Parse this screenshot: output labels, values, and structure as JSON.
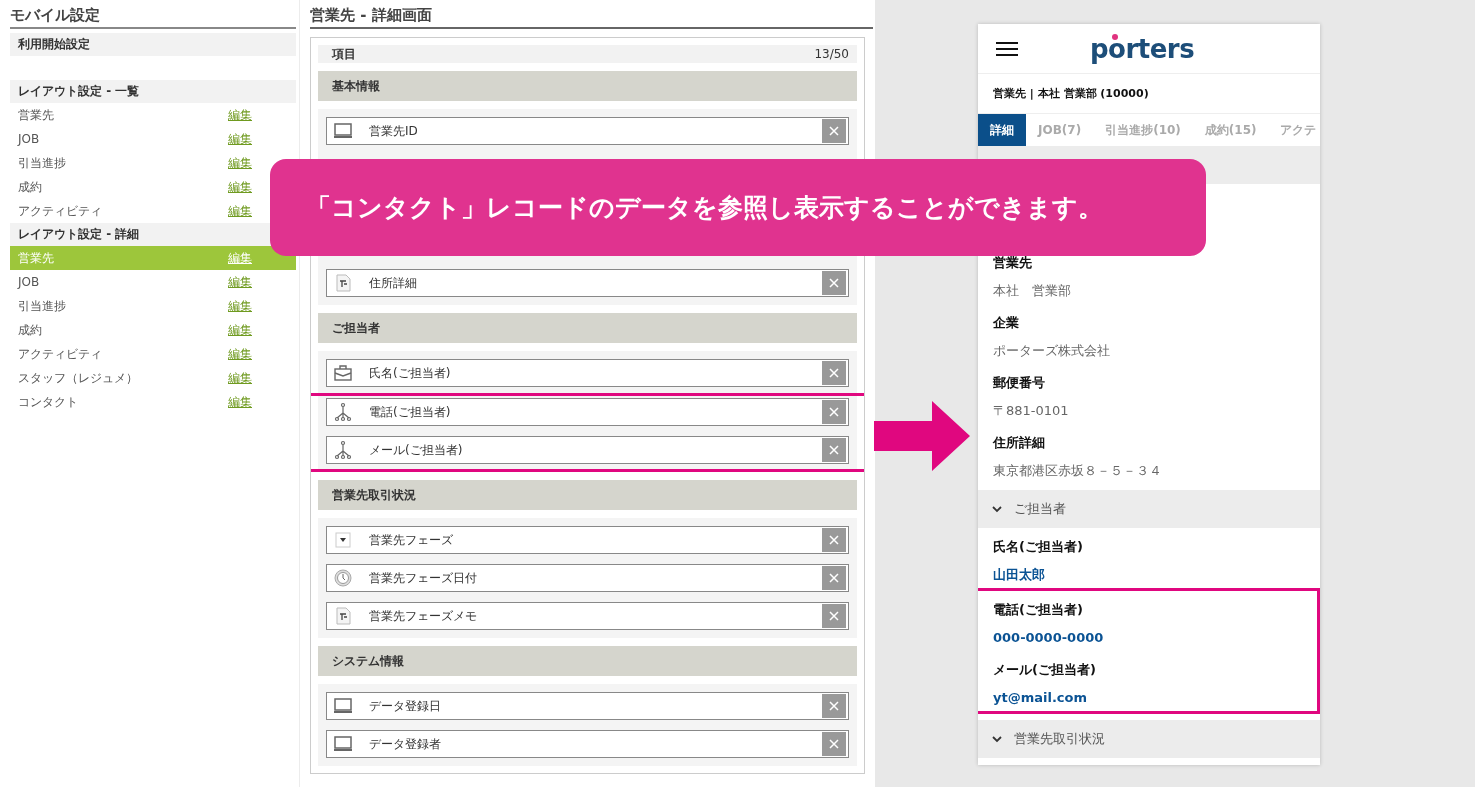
{
  "sidebar": {
    "title": "モバイル設定",
    "sections": [
      {
        "heading": "利用開始設定"
      },
      {
        "heading": "レイアウト設定 - 一覧",
        "items": [
          {
            "label": "営業先",
            "action": "編集",
            "selected": false
          },
          {
            "label": "JOB",
            "action": "編集",
            "selected": false
          },
          {
            "label": "引当進捗",
            "action": "編集",
            "selected": false
          },
          {
            "label": "成約",
            "action": "編集",
            "selected": false
          },
          {
            "label": "アクティビティ",
            "action": "編集",
            "selected": false
          }
        ]
      },
      {
        "heading": "レイアウト設定 - 詳細",
        "items": [
          {
            "label": "営業先",
            "action": "編集",
            "selected": true
          },
          {
            "label": "JOB",
            "action": "編集",
            "selected": false
          },
          {
            "label": "引当進捗",
            "action": "編集",
            "selected": false
          },
          {
            "label": "成約",
            "action": "編集",
            "selected": false
          },
          {
            "label": "アクティビティ",
            "action": "編集",
            "selected": false
          },
          {
            "label": "スタッフ（レジュメ）",
            "action": "編集",
            "selected": false
          },
          {
            "label": "コンタクト",
            "action": "編集",
            "selected": false
          }
        ]
      }
    ]
  },
  "editor": {
    "title": "営業先 - 詳細画面",
    "header": {
      "label": "項目",
      "count": "13/50"
    },
    "groups": [
      {
        "heading": "基本情報",
        "fields": [
          {
            "label": "営業先ID",
            "kind": "monitor",
            "highlighted": false
          },
          {
            "label": "住所詳細",
            "kind": "text",
            "highlighted": false
          }
        ]
      },
      {
        "heading": "ご担当者",
        "fields": [
          {
            "label": "氏名(ご担当者)",
            "kind": "briefcase",
            "highlighted": false
          },
          {
            "label": "電話(ご担当者)",
            "kind": "tree",
            "highlighted": true
          },
          {
            "label": "メール(ご担当者)",
            "kind": "tree",
            "highlighted": true
          }
        ]
      },
      {
        "heading": "営業先取引状況",
        "fields": [
          {
            "label": "営業先フェーズ",
            "kind": "dropdown",
            "highlighted": false
          },
          {
            "label": "営業先フェーズ日付",
            "kind": "clock",
            "highlighted": false
          },
          {
            "label": "営業先フェーズメモ",
            "kind": "text",
            "highlighted": false
          }
        ]
      },
      {
        "heading": "システム情報",
        "fields": [
          {
            "label": "データ登録日",
            "kind": "monitor",
            "highlighted": false
          },
          {
            "label": "データ登録者",
            "kind": "monitor",
            "highlighted": false
          }
        ]
      }
    ]
  },
  "phone": {
    "logo": "porters",
    "record_title": "営業先 | 本社 営業部 (10000)",
    "tabs": [
      {
        "label": "詳細",
        "selected": true
      },
      {
        "label": "JOB(7)",
        "selected": false
      },
      {
        "label": "引当進捗(10)",
        "selected": false
      },
      {
        "label": "成約(15)",
        "selected": false
      },
      {
        "label": "アクテ",
        "selected": false
      }
    ],
    "sections": [
      {
        "fields": [
          {
            "label": "営業先",
            "value": "本社　営業部",
            "kind": "text",
            "highlighted": false
          },
          {
            "label": "企業",
            "value": "ポーターズ株式会社",
            "kind": "text",
            "highlighted": false
          },
          {
            "label": "郵便番号",
            "value": "〒881-0101",
            "kind": "text",
            "highlighted": false
          },
          {
            "label": "住所詳細",
            "value": "東京都港区赤坂８－５－３４",
            "kind": "text",
            "highlighted": false
          }
        ]
      },
      {
        "heading": "ご担当者",
        "fields": [
          {
            "label": "氏名(ご担当者)",
            "value": "山田太郎",
            "kind": "link",
            "highlighted": false
          },
          {
            "label": "電話(ご担当者)",
            "value": "000-0000-0000",
            "kind": "link",
            "highlighted": true
          },
          {
            "label": "メール(ご担当者)",
            "value": "yt@mail.com",
            "kind": "link",
            "highlighted": true
          }
        ]
      },
      {
        "heading": "営業先取引状況"
      }
    ]
  },
  "banner": {
    "text": "「コンタクト」レコードのデータを参照し表示することができます。"
  }
}
